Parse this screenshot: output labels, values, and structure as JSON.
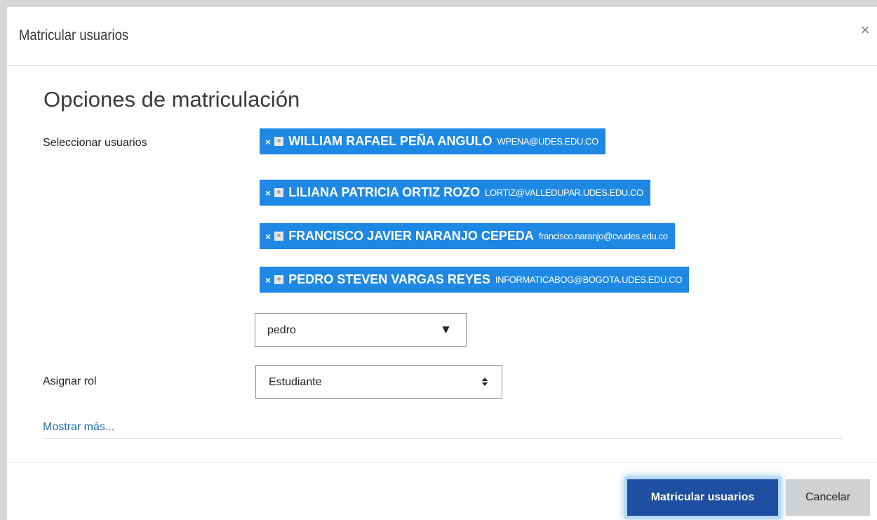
{
  "modal": {
    "title": "Matricular usuarios",
    "close_glyph": "×",
    "close_icon": "close-icon"
  },
  "form": {
    "section_title": "Opciones de matriculación",
    "select_users_label": "Seleccionar usuarios",
    "selected_users": [
      {
        "remove_glyph": "×",
        "name": "WILLIAM RAFAEL PEÑA ANGULO",
        "email": "WPENA@UDES.EDU.CO"
      },
      {
        "remove_glyph": "×",
        "name": "LILIANA PATRICIA ORTIZ ROZO",
        "email": "LORTIZ@VALLEDUPAR.UDES.EDU.CO"
      },
      {
        "remove_glyph": "×",
        "name": "FRANCISCO JAVIER NARANJO CEPEDA",
        "email": "francisco.naranjo@cvudes.edu.co"
      },
      {
        "remove_glyph": "×",
        "name": "PEDRO STEVEN VARGAS REYES",
        "email": "INFORMATICABOG@BOGOTA.UDES.EDU.CO"
      }
    ],
    "search_value": "pedro",
    "search_caret": "▼",
    "role_label": "Asignar rol",
    "role_value": "Estudiante",
    "show_more": "Mostrar más..."
  },
  "footer": {
    "submit_label": "Matricular usuarios",
    "cancel_label": "Cancelar"
  },
  "colors": {
    "chip_bg": "#1e88e5",
    "primary_btn": "#1e4fa0",
    "link": "#1f6aa5"
  }
}
